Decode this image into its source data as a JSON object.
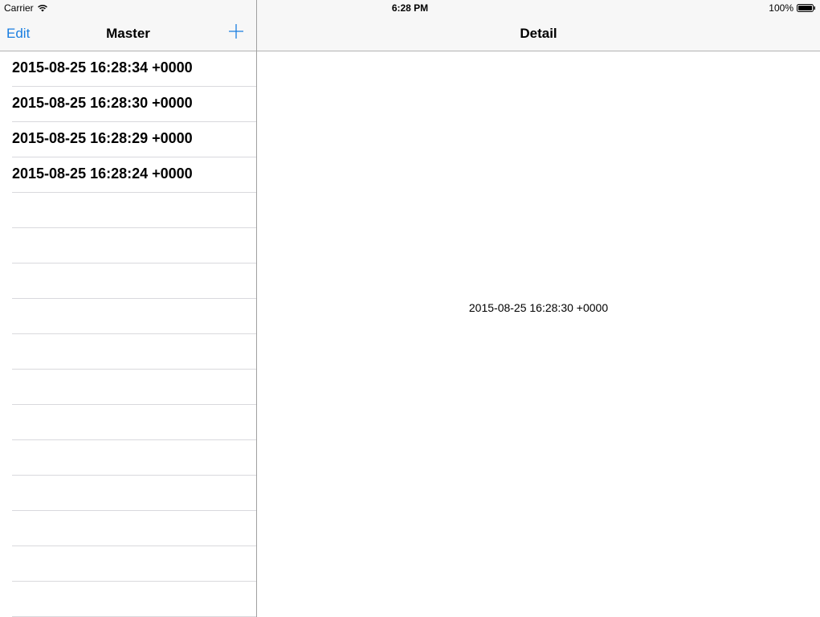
{
  "status_bar": {
    "carrier": "Carrier",
    "time": "6:28 PM",
    "battery": "100%"
  },
  "master": {
    "edit_label": "Edit",
    "title": "Master",
    "add_icon": "plus-icon",
    "rows": [
      "2015-08-25 16:28:34 +0000",
      "2015-08-25 16:28:30 +0000",
      "2015-08-25 16:28:29 +0000",
      "2015-08-25 16:28:24 +0000",
      "",
      "",
      "",
      "",
      "",
      "",
      "",
      "",
      "",
      "",
      "",
      ""
    ]
  },
  "detail": {
    "title": "Detail",
    "description": "2015-08-25 16:28:30 +0000"
  },
  "colors": {
    "tint": "#1a7ee0",
    "bar_background": "#f7f7f7",
    "separator": "#d9d9dd"
  }
}
